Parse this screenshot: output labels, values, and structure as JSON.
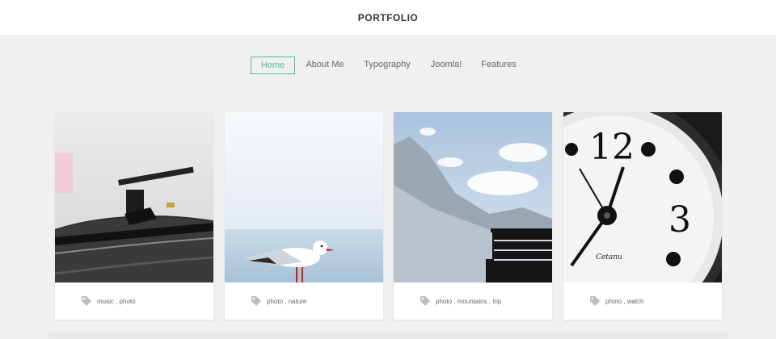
{
  "header": {
    "title": "PORTFOLIO"
  },
  "nav": {
    "items": [
      {
        "label": "Home",
        "active": true
      },
      {
        "label": "About Me",
        "active": false
      },
      {
        "label": "Typography",
        "active": false
      },
      {
        "label": "Joomla!",
        "active": false
      },
      {
        "label": "Features",
        "active": false
      }
    ]
  },
  "colors": {
    "accent": "#52b99a",
    "background": "#f0f0f0"
  },
  "portfolio": {
    "items": [
      {
        "image": "record-player-photo",
        "tags": "music , photo"
      },
      {
        "image": "seagull-photo",
        "tags": "photo , nature"
      },
      {
        "image": "mountains-photo",
        "tags": "photo , mountains , trip"
      },
      {
        "image": "clock-photo",
        "tags": "photo , watch"
      }
    ]
  }
}
